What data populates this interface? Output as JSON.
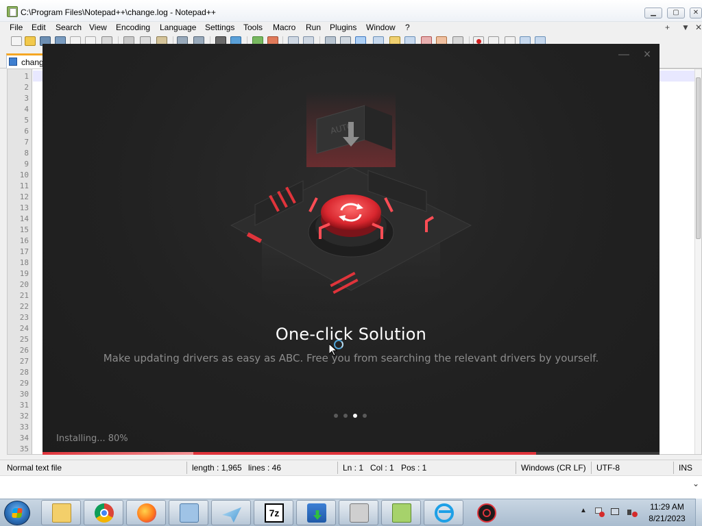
{
  "window": {
    "title": "C:\\Program Files\\Notepad++\\change.log - Notepad++",
    "min_label": "▁",
    "max_label": "▢",
    "close_label": "✕"
  },
  "menu": {
    "items": [
      "File",
      "Edit",
      "Search",
      "View",
      "Encoding",
      "Language",
      "Settings",
      "Tools",
      "Macro",
      "Run",
      "Plugins",
      "Window",
      "?"
    ],
    "right": [
      "+",
      "▼",
      "✕"
    ]
  },
  "tab": {
    "label": "chang"
  },
  "editor": {
    "line_numbers": [
      "1",
      "2",
      "3",
      "4",
      "5",
      "6",
      "7",
      "8",
      "9",
      "10",
      "11",
      "12",
      "13",
      "14",
      "15",
      "16",
      "17",
      "18",
      "19",
      "20",
      "21",
      "22",
      "23",
      "24",
      "25",
      "26",
      "27",
      "28",
      "29",
      "30",
      "31",
      "32",
      "33",
      "34",
      "35"
    ]
  },
  "statusbar": {
    "file_type": "Normal text file",
    "length": "length : 1,965",
    "lines": "lines : 46",
    "ln": "Ln : 1",
    "col": "Col : 1",
    "pos": "Pos : 1",
    "eol": "Windows (CR LF)",
    "encoding": "UTF-8",
    "mode": "INS"
  },
  "installer": {
    "title": "One-click Solution",
    "description": "Make updating drivers as easy as ABC. Free you from searching the relevant drivers by yourself.",
    "status": "Installing... 80%",
    "progress": 0.8,
    "slides": 4,
    "active_slide": 2,
    "hero_label": "AUTO",
    "accent_color": "#e0343b"
  },
  "taskbar": {
    "apps": [
      "windows-explorer",
      "google-chrome",
      "firefox",
      "control-panel",
      "blue-plane-app",
      "7-zip",
      "iobit-driver-booster-installer",
      "printer",
      "notepad-plus-plus",
      "internet-explorer",
      "driver-booster"
    ],
    "clock_time": "11:29 AM",
    "clock_date": "8/21/2023"
  }
}
